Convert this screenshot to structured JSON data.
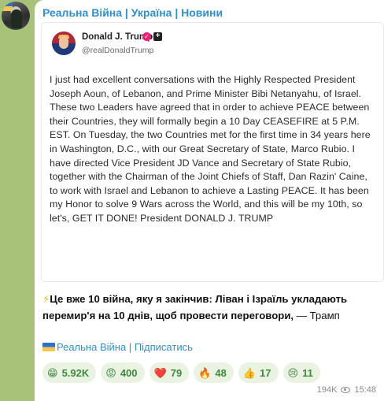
{
  "channel": {
    "title": "Реальна Війна | Україна | Новини"
  },
  "card": {
    "author_name": "Donald J. Trump",
    "handle": "@realDonaldTrump",
    "text": "I just had excellent conversations with the Highly Respected President Joseph Aoun, of Lebanon, and Prime Minister Bibi Netanyahu, of Israel. These two Leaders have agreed that in order to achieve PEACE between their Countries, they will formally begin a 10 Day CEASEFIRE at 5 P.M. EST. On Tuesday, the two Countries met for the first time in 34 years here in Washington, D.C., with our Great Secretary of State, Marco Rubio. I have directed Vice President JD Vance and Secretary of State Rubio, together with the Chairman of the Joint Chiefs of Staff, Dan Razin' Caine, to work with Israel and Lebanon to achieve a Lasting PEACE. It has been my Honor to solve 9 Wars across the World, and this will be my 10th, so let's, GET IT DONE! President DONALD J. TRUMP"
  },
  "headline": {
    "bold": "Це вже 10 війна, яку я закінчив: Ліван і Ізраїль укладають перемир'я на 10 днів, щоб провести переговори,",
    "tail": " — Трамп"
  },
  "subscribe": {
    "channel_label": "Реальна Війна",
    "separator": "|",
    "action": "Підписатись"
  },
  "reactions": [
    {
      "icon": "grinning-face-icon",
      "emoji": "😁",
      "count": "5.92K"
    },
    {
      "icon": "angry-face-icon",
      "emoji": "😡",
      "count": "400"
    },
    {
      "icon": "heart-icon",
      "emoji": "❤️",
      "count": "79"
    },
    {
      "icon": "fire-icon",
      "emoji": "🔥",
      "count": "48"
    },
    {
      "icon": "thumbs-up-icon",
      "emoji": "👍",
      "count": "17"
    },
    {
      "icon": "crying-face-icon",
      "emoji": "😢",
      "count": "11"
    }
  ],
  "meta": {
    "views": "194K",
    "time": "15:48"
  }
}
